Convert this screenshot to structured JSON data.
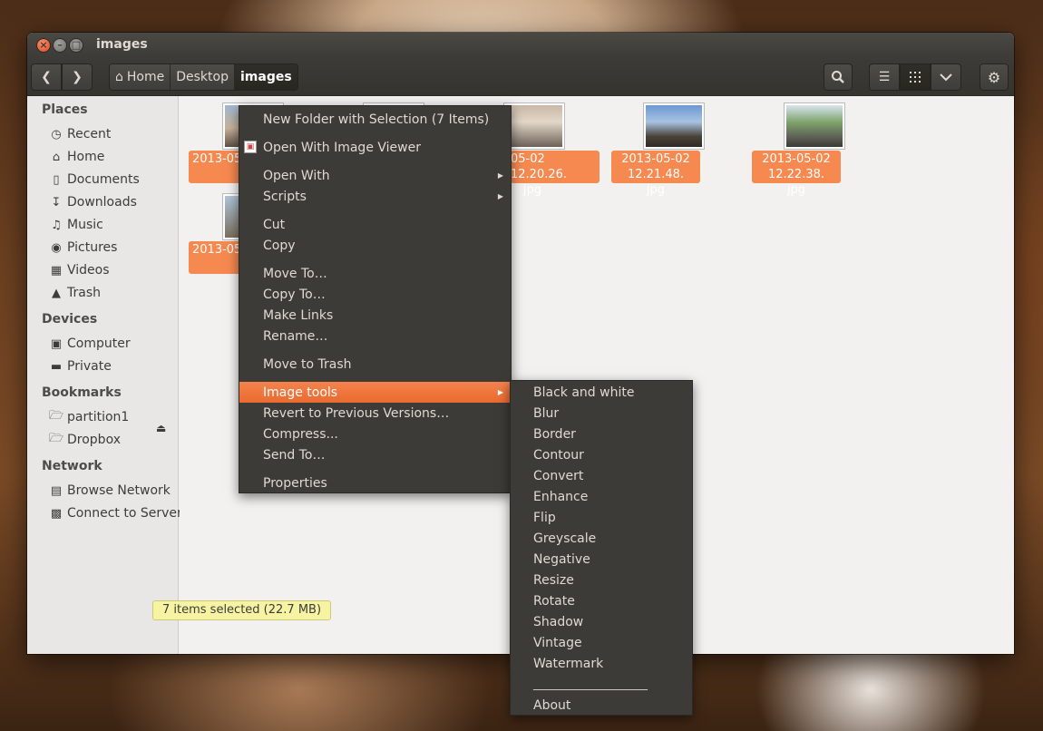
{
  "window": {
    "title": "images"
  },
  "titlebar": {
    "close_icon": "close-icon",
    "minimize_icon": "minimize-icon",
    "maximize_icon": "maximize-icon"
  },
  "toolbar": {
    "breadcrumbs": [
      "Home",
      "Desktop",
      "images"
    ],
    "icons": [
      "back-arrow-icon",
      "forward-arrow-icon",
      "search-icon",
      "list-view-icon",
      "grid-view-icon",
      "chevron-down-icon",
      "gear-icon"
    ]
  },
  "sidebar": {
    "places_header": "Places",
    "places": [
      {
        "label": "Recent",
        "icon": "clock-icon"
      },
      {
        "label": "Home",
        "icon": "home-icon"
      },
      {
        "label": "Documents",
        "icon": "document-icon"
      },
      {
        "label": "Downloads",
        "icon": "download-icon"
      },
      {
        "label": "Music",
        "icon": "music-icon"
      },
      {
        "label": "Pictures",
        "icon": "camera-icon"
      },
      {
        "label": "Videos",
        "icon": "film-icon"
      },
      {
        "label": "Trash",
        "icon": "trash-icon"
      }
    ],
    "devices_header": "Devices",
    "devices": [
      {
        "label": "Computer",
        "icon": "computer-icon"
      },
      {
        "label": "Private",
        "icon": "drive-icon"
      }
    ],
    "bookmarks_header": "Bookmarks",
    "bookmarks": [
      {
        "label": "partition1",
        "icon": "folder-icon"
      },
      {
        "label": "Dropbox",
        "icon": "folder-icon"
      }
    ],
    "network_header": "Network",
    "network": [
      {
        "label": "Browse Network",
        "icon": "network-icon"
      },
      {
        "label": "Connect to Server",
        "icon": "server-icon"
      }
    ]
  },
  "files": [
    {
      "line1": "2013-05",
      "line2": ""
    },
    {
      "line1": "",
      "line2": ""
    },
    {
      "line1": "05-02 12.20.26.",
      "line2": "jpg"
    },
    {
      "line1": "2013-05-02 12.21.48.",
      "line2": "jpg"
    },
    {
      "line1": "2013-05-02 12.22.38.",
      "line2": "jpg"
    },
    {
      "line1": "2013-05",
      "line2": ""
    }
  ],
  "context_menu": {
    "items": [
      "New Folder with Selection (7 Items)",
      "Open With Image Viewer",
      "Open With",
      "Scripts",
      "Cut",
      "Copy",
      "Move To…",
      "Copy To…",
      "Make Links",
      "Rename…",
      "Move to Trash",
      "Image tools",
      "Revert to Previous Versions…",
      "Compress...",
      "Send To…",
      "Properties"
    ],
    "highlighted": "Image tools",
    "highlight_color": "#f07746"
  },
  "image_tools_menu": {
    "items": [
      "Black and white",
      "Blur",
      "Border",
      "Contour",
      "Convert",
      "Enhance",
      "Flip",
      "Greyscale",
      "Negative",
      "Resize",
      "Rotate",
      "Shadow",
      "Vintage",
      "Watermark"
    ],
    "separator": "_____________________",
    "about": "About"
  },
  "status": {
    "text": "7 items selected  (22.7 MB)"
  },
  "colors": {
    "accent": "#f58950",
    "menu_bg": "#3c3b37",
    "status_bg": "#f6f3a3"
  }
}
